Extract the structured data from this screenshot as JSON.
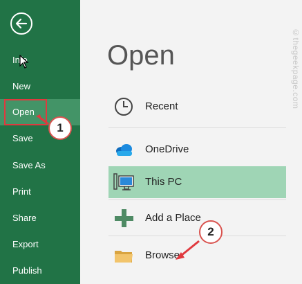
{
  "sidebar": {
    "items": [
      {
        "label": "Info"
      },
      {
        "label": "New"
      },
      {
        "label": "Open"
      },
      {
        "label": "Save"
      },
      {
        "label": "Save As"
      },
      {
        "label": "Print"
      },
      {
        "label": "Share"
      },
      {
        "label": "Export"
      },
      {
        "label": "Publish"
      }
    ],
    "active": "Open",
    "back_icon": "back-arrow-icon"
  },
  "main": {
    "title": "Open",
    "locations": [
      {
        "label": "Recent",
        "icon": "clock-icon"
      },
      {
        "label": "OneDrive",
        "icon": "cloud-icon"
      },
      {
        "label": "This PC",
        "icon": "computer-icon",
        "selected": true
      },
      {
        "label": "Add a Place",
        "icon": "plus-icon"
      },
      {
        "label": "Browse",
        "icon": "folder-icon"
      }
    ]
  },
  "annotations": {
    "step1": "1",
    "step2": "2"
  },
  "watermark": "©thegeekpage.com",
  "colors": {
    "sidebar": "#217346",
    "selected_nav": "#439467",
    "selected_location": "#9fd5b5",
    "annotation": "#e0393e"
  }
}
